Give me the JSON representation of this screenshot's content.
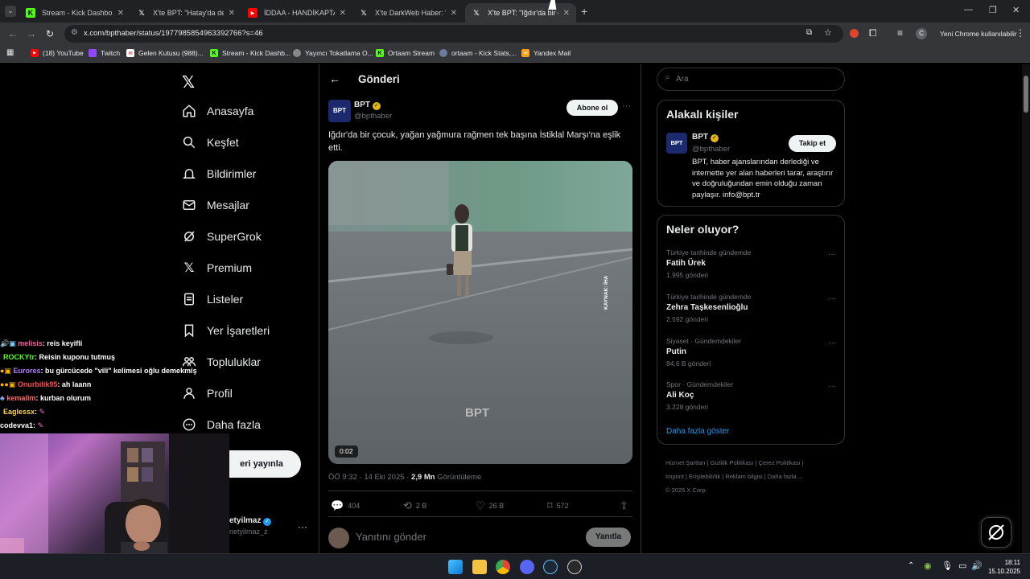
{
  "browser": {
    "tabs": [
      {
        "title": "Stream - Kick Dashboard",
        "active": false
      },
      {
        "title": "X'te BPT: \"Hatay'da depre",
        "active": false
      },
      {
        "title": "İDDAA - HANDİKAPTAN K",
        "active": false
      },
      {
        "title": "X'te DarkWeb Haber: \"İst",
        "active": false
      },
      {
        "title": "X'te BPT: \"Iğdır'da bir ço",
        "active": true
      }
    ],
    "url": "x.com/bpthaber/status/1977985854963392766?s=46",
    "update_label": "Yeni Chrome kullanılabilir",
    "bookmarks": [
      "(18) YouTube",
      "Twitch",
      "Gelen Kutusu (988)...",
      "Stream - Kick Dashb...",
      "Yayıncı Tokatlama O...",
      "Ortaam Stream",
      "ortaam - Kick Stats,...",
      "Yandex Mail"
    ],
    "colors": {
      "kick": "#53fc18",
      "youtube": "#ff0000",
      "twitch": "#9146ff",
      "yandex": "#fc3f1d"
    }
  },
  "nav": {
    "items": [
      "Anasayfa",
      "Keşfet",
      "Bildirimler",
      "Mesajlar",
      "SuperGrok",
      "Premium",
      "Listeler",
      "Yer İşaretleri",
      "Topluluklar",
      "Profil",
      "Daha fazla"
    ],
    "post_button": "eri yayınla",
    "account_name": "etyilmaz",
    "account_handle": "netyilmaz_z"
  },
  "post": {
    "header": "Gönderi",
    "author": "BPT",
    "handle": "@bpthaber",
    "subscribe": "Abone ol",
    "text": "Iğdır'da bir çocuk, yağan yağmura rağmen tek başına İstiklal Marşı'na eşlik etti.",
    "video_duration": "0:02",
    "video_source": "KAYNAK: İHA",
    "video_watermark": "BPT",
    "time": "ÖÖ 9:32 · 14 Eki 2025 · ",
    "views": "2,9 Mn",
    "views_label": " Görüntüleme",
    "replies": "404",
    "reposts": "2 B",
    "likes": "26 B",
    "bookmarks": "572",
    "reply_placeholder": "Yanıtını gönder",
    "reply_button": "Yanıtla"
  },
  "sidebar": {
    "search_placeholder": "Ara",
    "relevant_title": "Alakalı kişiler",
    "relevant": {
      "name": "BPT",
      "handle": "@bpthaber",
      "follow": "Takip et",
      "bio": "BPT, haber ajanslarından derlediği ve internette yer alan haberleri tarar, araştırır ve doğruluğundan emin olduğu zaman paylaşır. info@bpt.tr"
    },
    "trends_title": "Neler oluyor?",
    "trends": [
      {
        "meta": "Türkiye tarihinde gündemde",
        "name": "Fatih Ürek",
        "count": "1.995 gönderi"
      },
      {
        "meta": "Türkiye tarihinde gündemde",
        "name": "Zehra Taşkesenlioğlu",
        "count": "2.592 gönderi"
      },
      {
        "meta": "Siyaset · Gündemdekiler",
        "name": "Putin",
        "count": "84,6 B gönderi"
      },
      {
        "meta": "Spor · Gündemdekiler",
        "name": "Ali Koç",
        "count": "3.228 gönderi"
      }
    ],
    "show_more": "Daha fazla göster",
    "footer": [
      "Hizmet Şartları",
      "Gizlilik Politikası",
      "Çerez Politikası",
      "Imprint",
      "Erişilebilirlik",
      "Reklam bilgisi",
      "Daha fazla ...",
      "© 2025 X Corp."
    ]
  },
  "chat": [
    {
      "user": "melisis",
      "msg": ": reis keyifli",
      "color": "#ff5fa2"
    },
    {
      "user": "ROCKYtr",
      "msg": ": Reisin kuponu tutmuş",
      "color": "#53fc18"
    },
    {
      "user": "Eurores",
      "msg": ": bu gürcücede \"vili\" kelimesi oğlu demekmiş",
      "color": "#b57cff"
    },
    {
      "user": "Onurbilik95",
      "msg": ": ah laann",
      "color": "#ff4d4d"
    },
    {
      "user": "kemalim",
      "msg": ": kurban olurum",
      "color": "#ff6a6a"
    },
    {
      "user": "Eaglessx",
      "msg": ":",
      "color": "#ffd54a"
    },
    {
      "user": "codevva1",
      "msg": ":",
      "color": "#ffffff"
    }
  ],
  "clock": {
    "time": "18:11",
    "date": "15.10.2025"
  }
}
